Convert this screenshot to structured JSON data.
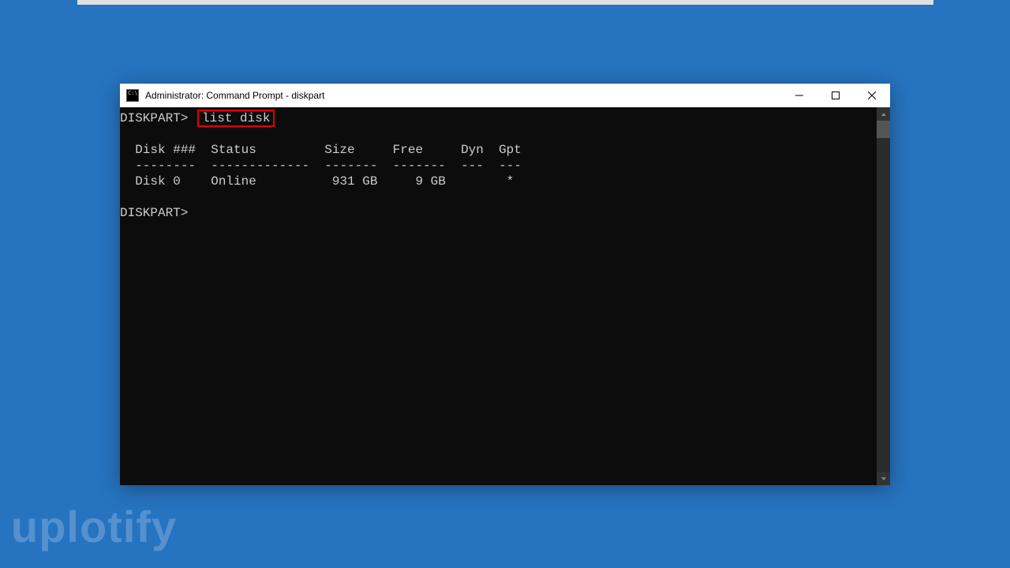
{
  "window": {
    "title": "Administrator: Command Prompt - diskpart"
  },
  "terminal": {
    "prompt1": "DISKPART>",
    "command1": "list disk",
    "blank": "",
    "header": "  Disk ###  Status         Size     Free     Dyn  Gpt",
    "divider": "  --------  -------------  -------  -------  ---  ---",
    "row0": "  Disk 0    Online          931 GB     9 GB        *",
    "prompt2": "DISKPART>"
  },
  "watermark": "uplotify"
}
